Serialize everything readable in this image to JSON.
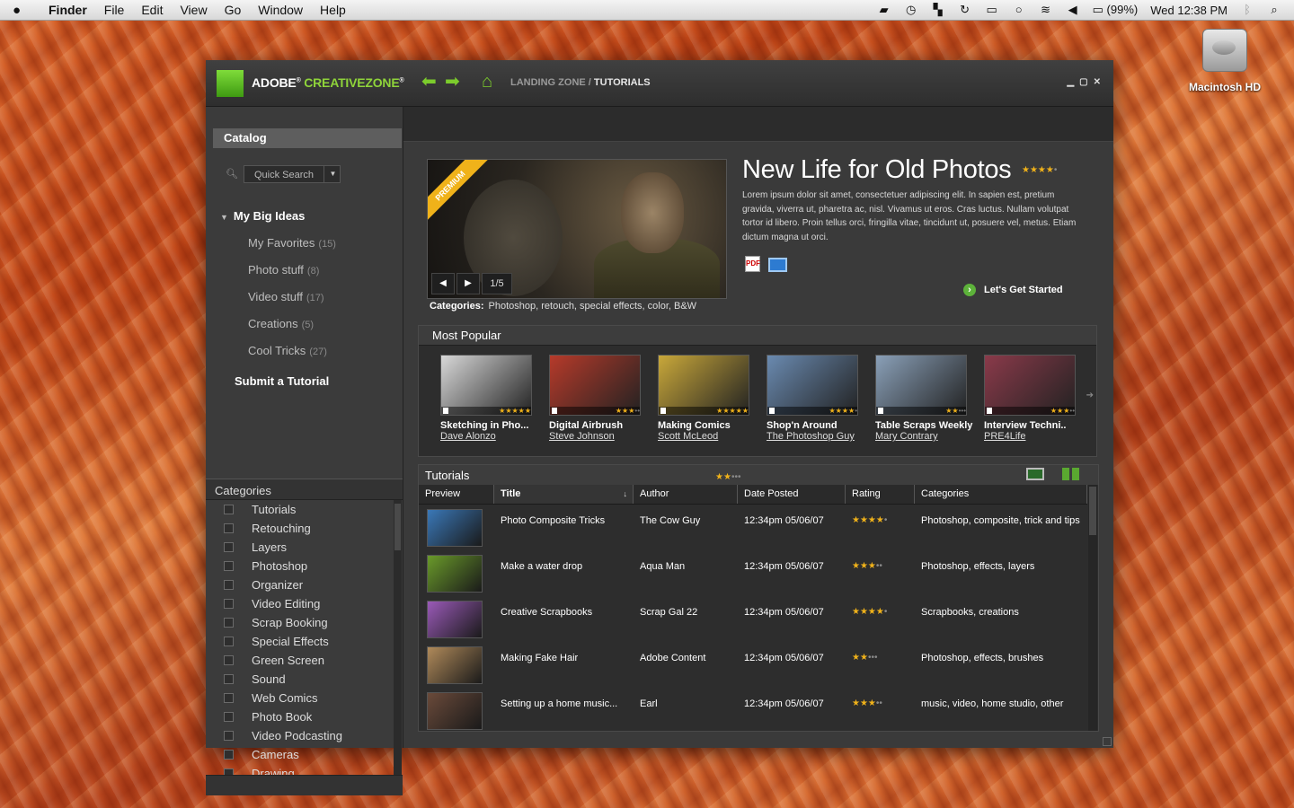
{
  "menubar": {
    "apple": "",
    "items": [
      "Finder",
      "File",
      "Edit",
      "View",
      "Go",
      "Window",
      "Help"
    ],
    "battery": "(99%)",
    "clock": "Wed 12:38 PM"
  },
  "desktop": {
    "hd_label": "Macintosh HD"
  },
  "app": {
    "brand_adobe": "ADOBE",
    "brand_reg": "®",
    "brand_cz": "CREATIVEZONE",
    "brand_reg2": "®",
    "breadcrumb_root": "LANDING ZONE",
    "breadcrumb_sep": " / ",
    "breadcrumb_current": "TUTORIALS",
    "winctrl": [
      "▁",
      "▢",
      "✕"
    ]
  },
  "sidebar": {
    "catalog": "Catalog",
    "search_placeholder": "Quick Search",
    "group": "My Big Ideas",
    "favorites": [
      {
        "label": "My Favorites",
        "count": "(15)"
      },
      {
        "label": "Photo stuff",
        "count": "(8)"
      },
      {
        "label": "Video stuff",
        "count": "(17)"
      },
      {
        "label": "Creations",
        "count": "(5)"
      },
      {
        "label": "Cool Tricks",
        "count": "(27)"
      }
    ],
    "submit": "Submit a Tutorial",
    "categories_title": "Categories",
    "categories": [
      "Tutorials",
      "Retouching",
      "Layers",
      "Photoshop",
      "Organizer",
      "Video Editing",
      "Scrap Booking",
      "Special Effects",
      "Green Screen",
      "Sound",
      "Web Comics",
      "Photo Book",
      "Video Podcasting",
      "Cameras",
      "Drawing"
    ]
  },
  "hero": {
    "badge": "PREMIUM",
    "page": "1/5",
    "categories_label": "Categories:",
    "categories": "Photoshop, retouch, special effects, color, B&W",
    "title": "New Life for Old Photos",
    "rating": 4,
    "description": "Lorem ipsum dolor sit amet, consectetuer adipiscing elit. In sapien est, pretium gravida, viverra ut, pharetra ac, nisl. Vivamus ut eros. Cras luctus. Nullam volutpat tortor id libero. Proin tellus orci, fringilla vitae, tincidunt ut, posuere vel, metus. Etiam dictum magna ut orci.",
    "cta": "Let's Get Started"
  },
  "popular": {
    "title": "Most Popular",
    "items": [
      {
        "title": "Sketching in Pho...",
        "author": "Dave Alonzo",
        "rating": 5,
        "color": "#d8d8d8"
      },
      {
        "title": "Digital Airbrush",
        "author": "Steve Johnson",
        "rating": 3,
        "color": "#b63a2a"
      },
      {
        "title": "Making Comics",
        "author": "Scott McLeod",
        "rating": 5,
        "color": "#c9a83a"
      },
      {
        "title": "Shop'n Around",
        "author": "The Photoshop Guy",
        "rating": 4,
        "color": "#6a8ab0"
      },
      {
        "title": "Table Scraps Weekly",
        "author": "Mary Contrary",
        "rating": 2,
        "color": "#8aa0b8"
      },
      {
        "title": "Interview Techni..",
        "author": "PRE4Life",
        "rating": 3,
        "color": "#8a3a4a"
      }
    ]
  },
  "tutorials": {
    "title": "Tutorials",
    "rating": 2,
    "columns": [
      "Preview",
      "Title",
      "Author",
      "Date Posted",
      "Rating",
      "Categories"
    ],
    "rows": [
      {
        "title": "Photo Composite Tricks",
        "author": "The Cow Guy",
        "date": "12:34pm 05/06/07",
        "rating": 4,
        "categories": "Photoshop, composite, trick and tips",
        "color": "#3a78b8"
      },
      {
        "title": "Make a water drop",
        "author": "Aqua Man",
        "date": "12:34pm 05/06/07",
        "rating": 3,
        "categories": "Photoshop, effects, layers",
        "color": "#6a9a2a"
      },
      {
        "title": "Creative Scrapbooks",
        "author": "Scrap Gal 22",
        "date": "12:34pm 05/06/07",
        "rating": 4,
        "categories": "Scrapbooks, creations",
        "color": "#9a5ab8"
      },
      {
        "title": "Making Fake Hair",
        "author": "Adobe  Content",
        "date": "12:34pm 05/06/07",
        "rating": 2,
        "categories": "Photoshop, effects, brushes",
        "color": "#b08a5a"
      },
      {
        "title": "Setting up a home music...",
        "author": "Earl",
        "date": "12:34pm 05/06/07",
        "rating": 3,
        "categories": "music, video, home studio, other",
        "color": "#6a4a3a"
      }
    ]
  }
}
